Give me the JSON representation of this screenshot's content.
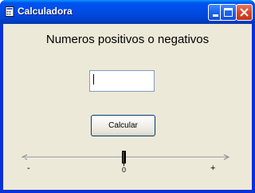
{
  "window": {
    "title": "Calculadora",
    "icon": "app-icon",
    "controls": [
      "minimize-icon",
      "maximize-icon",
      "close-icon"
    ]
  },
  "main": {
    "heading": "Numeros positivos o negativos",
    "input": {
      "value": "",
      "placeholder": ""
    },
    "calculate_button": "Calcular",
    "slider": {
      "min_label": "-",
      "max_label": "+",
      "center_label": "0",
      "value_fraction": 0.5
    }
  },
  "colors": {
    "titlebar": "#0050ee",
    "client_background": "#ece9d8",
    "close_button": "#d9472b"
  }
}
